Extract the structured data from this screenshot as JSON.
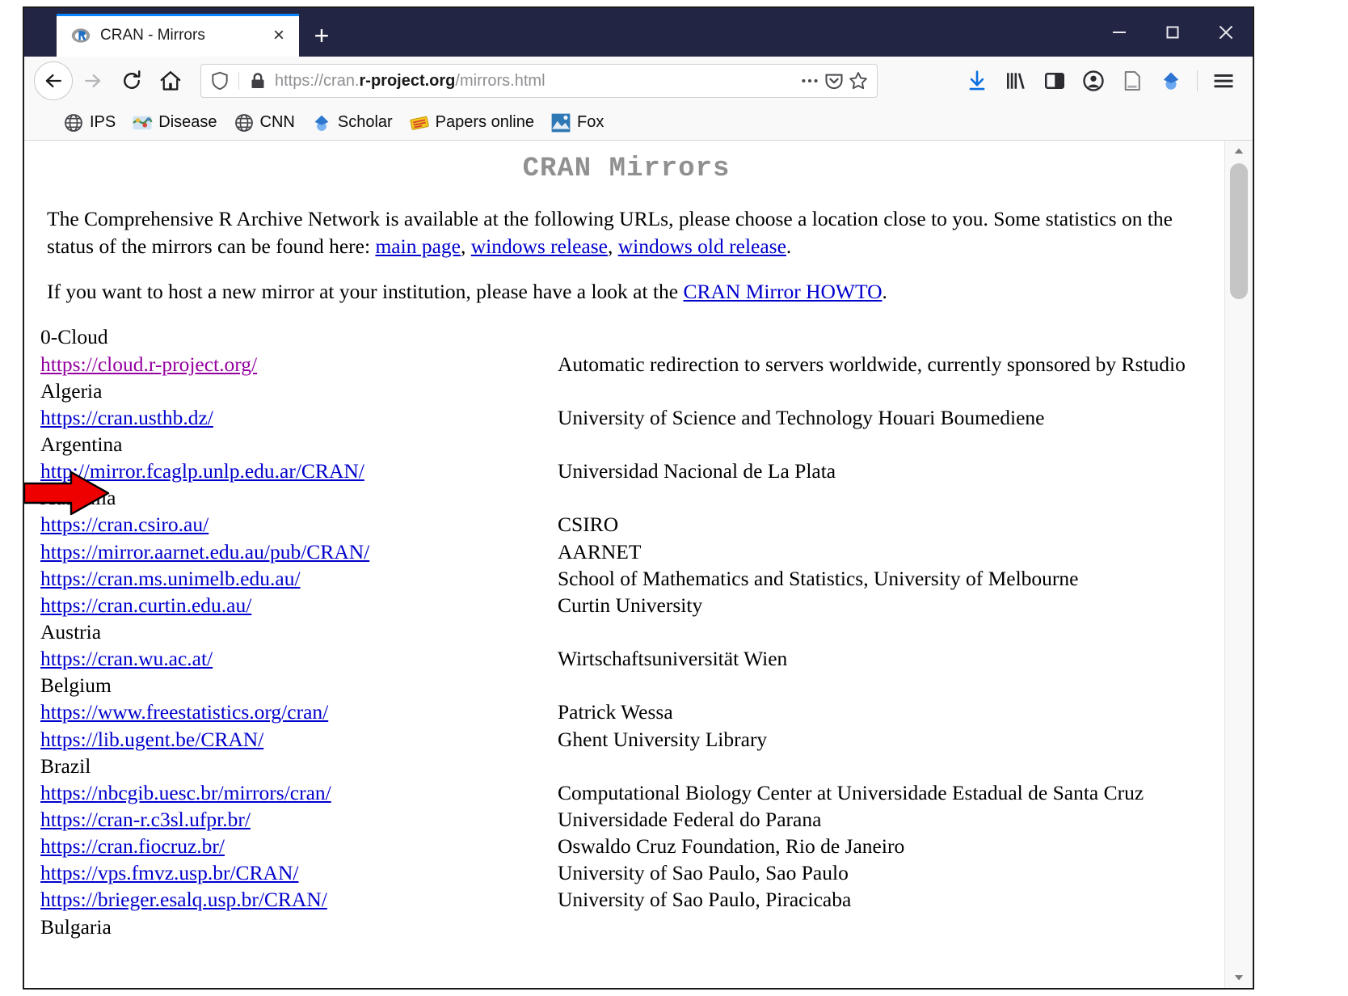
{
  "window": {
    "controls": {
      "minimize": "minimize-button",
      "maximize": "maximize-button",
      "close": "close-button"
    }
  },
  "tab": {
    "title": "CRAN - Mirrors",
    "favicon": "r-logo-icon",
    "close_label": "×",
    "newtab_label": "+"
  },
  "nav": {
    "back": "back-icon",
    "forward": "forward-icon",
    "reload": "reload-icon",
    "home": "home-icon"
  },
  "urlbar": {
    "scheme": "https://cran.",
    "domain": "r-project.org",
    "path": "/mirrors.html",
    "shield_icon": "shield-icon",
    "lock_icon": "padlock-icon",
    "more_icon": "ellipsis-icon",
    "pocket_icon": "pocket-icon",
    "bookmark_icon": "star-icon"
  },
  "toolbar_right": {
    "downloads": "download-arrow-icon",
    "library": "library-books-icon",
    "sidebar": "sidebar-panel-icon",
    "account": "account-circle-icon",
    "reader": "page-document-icon",
    "extension": "blue-diamond-extension-icon",
    "menu": "hamburger-menu-icon"
  },
  "bookmarks": [
    {
      "label": "IPS",
      "icon": "globe-icon"
    },
    {
      "label": "Disease",
      "icon": "disease-map-icon"
    },
    {
      "label": "CNN",
      "icon": "globe-icon"
    },
    {
      "label": "Scholar",
      "icon": "blue-diamond-icon"
    },
    {
      "label": "Papers online",
      "icon": "yellow-papers-icon"
    },
    {
      "label": "Fox",
      "icon": "fox-photo-icon"
    }
  ],
  "page": {
    "title": "CRAN Mirrors",
    "intro_before": "The Comprehensive R Archive Network is available at the following URLs, please choose a location close to you. Some statistics on the status of the mirrors can be found here: ",
    "intro_links": [
      {
        "text": "main page",
        "sep": ", "
      },
      {
        "text": "windows release",
        "sep": ", "
      },
      {
        "text": "windows old release",
        "sep": "."
      }
    ],
    "host_before": "If you want to host a new mirror at your institution, please have a look at the ",
    "host_link": "CRAN Mirror HOWTO",
    "host_after": ".",
    "rows": [
      {
        "type": "country",
        "name": "0-Cloud"
      },
      {
        "type": "mirror",
        "url": "https://cloud.r-project.org/",
        "desc": "Automatic redirection to servers worldwide, currently sponsored by Rstudio",
        "visited": true
      },
      {
        "type": "country",
        "name": "Algeria"
      },
      {
        "type": "mirror",
        "url": "https://cran.usthb.dz/",
        "desc": "University of Science and Technology Houari Boumediene",
        "visited": false
      },
      {
        "type": "country",
        "name": "Argentina"
      },
      {
        "type": "mirror",
        "url": "http://mirror.fcaglp.unlp.edu.ar/CRAN/",
        "desc": "Universidad Nacional de La Plata",
        "visited": false
      },
      {
        "type": "country",
        "name": "Australia"
      },
      {
        "type": "mirror",
        "url": "https://cran.csiro.au/",
        "desc": "CSIRO",
        "visited": false
      },
      {
        "type": "mirror",
        "url": "https://mirror.aarnet.edu.au/pub/CRAN/",
        "desc": "AARNET",
        "visited": false
      },
      {
        "type": "mirror",
        "url": "https://cran.ms.unimelb.edu.au/",
        "desc": "School of Mathematics and Statistics, University of Melbourne",
        "visited": false
      },
      {
        "type": "mirror",
        "url": "https://cran.curtin.edu.au/",
        "desc": "Curtin University",
        "visited": false
      },
      {
        "type": "country",
        "name": "Austria"
      },
      {
        "type": "mirror",
        "url": "https://cran.wu.ac.at/",
        "desc": "Wirtschaftsuniversität Wien",
        "visited": false
      },
      {
        "type": "country",
        "name": "Belgium"
      },
      {
        "type": "mirror",
        "url": "https://www.freestatistics.org/cran/",
        "desc": "Patrick Wessa",
        "visited": false
      },
      {
        "type": "mirror",
        "url": "https://lib.ugent.be/CRAN/",
        "desc": "Ghent University Library",
        "visited": false
      },
      {
        "type": "country",
        "name": "Brazil"
      },
      {
        "type": "mirror",
        "url": "https://nbcgib.uesc.br/mirrors/cran/",
        "desc": "Computational Biology Center at Universidade Estadual de Santa Cruz",
        "visited": false
      },
      {
        "type": "mirror",
        "url": "https://cran-r.c3sl.ufpr.br/",
        "desc": "Universidade Federal do Parana",
        "visited": false
      },
      {
        "type": "mirror",
        "url": "https://cran.fiocruz.br/",
        "desc": "Oswaldo Cruz Foundation, Rio de Janeiro",
        "visited": false
      },
      {
        "type": "mirror",
        "url": "https://vps.fmvz.usp.br/CRAN/",
        "desc": "University of Sao Paulo, Sao Paulo",
        "visited": false
      },
      {
        "type": "mirror",
        "url": "https://brieger.esalq.usp.br/CRAN/",
        "desc": "University of Sao Paulo, Piracicaba",
        "visited": false
      },
      {
        "type": "country",
        "name": "Bulgaria"
      }
    ]
  },
  "annotation": {
    "arrow": "red-arrow-pointing-at-cloud-mirror-link",
    "color": "#ee0000"
  },
  "scrollbar": {
    "up": "scroll-up-arrow",
    "down": "scroll-down-arrow"
  }
}
